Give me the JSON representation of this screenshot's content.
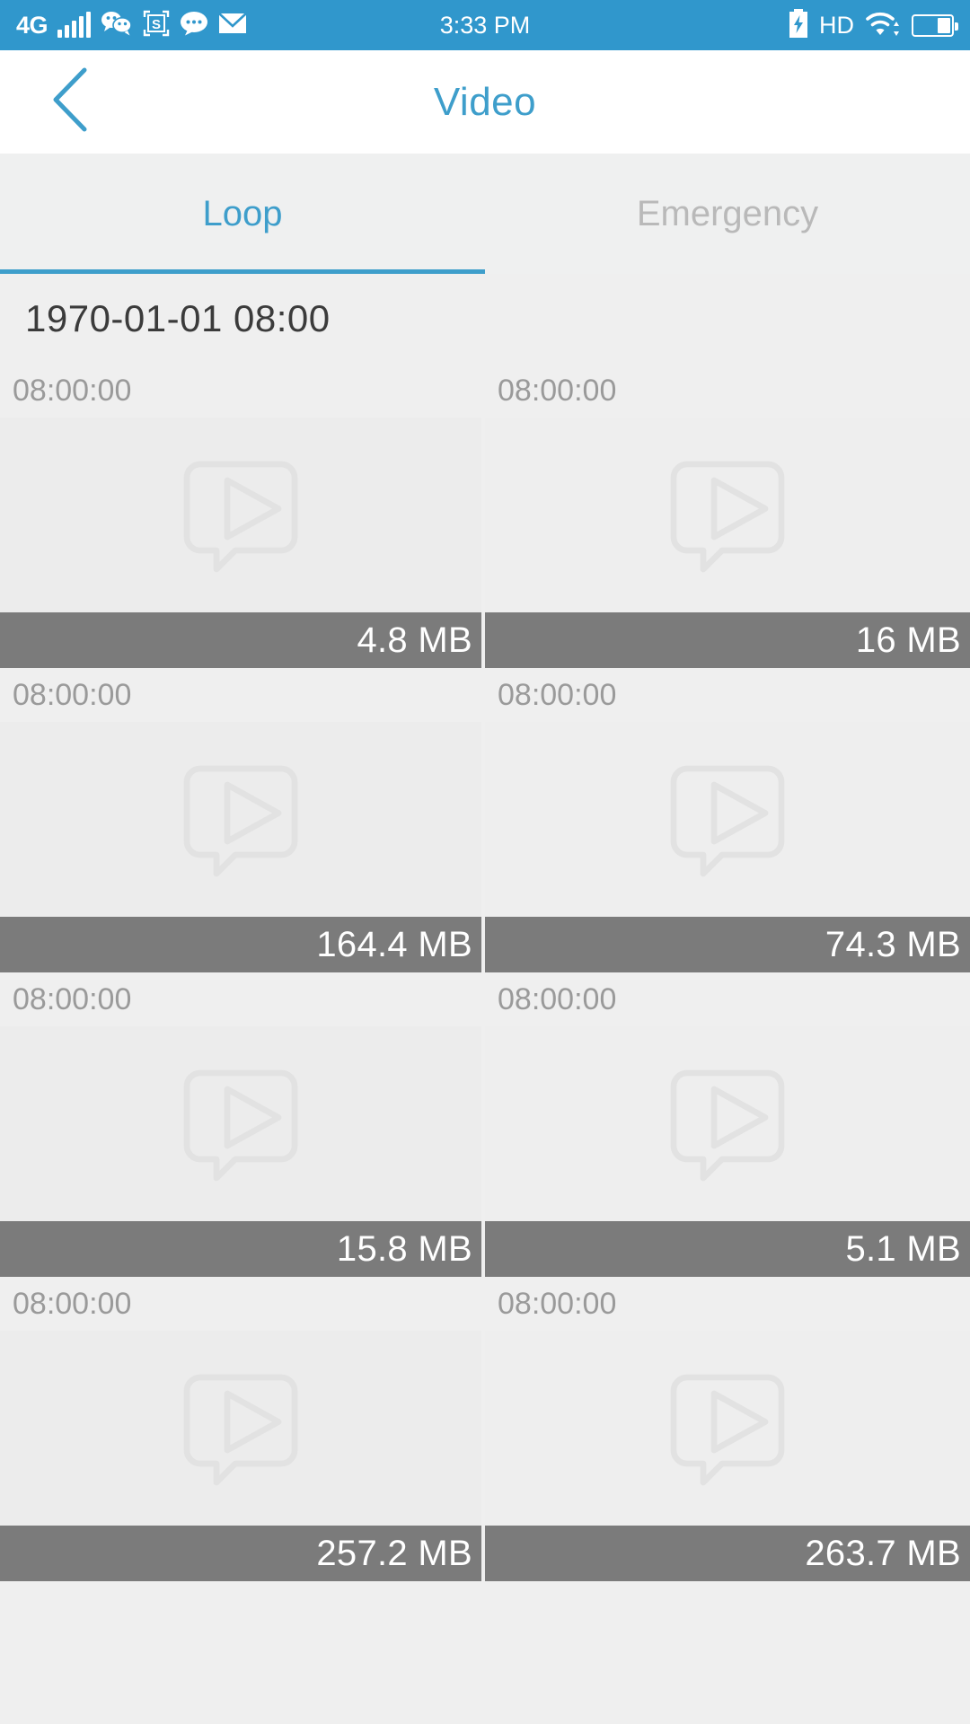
{
  "status_bar": {
    "network_label": "4G",
    "signal_bars": 5,
    "time": "3:33 PM",
    "hd_label": "HD",
    "icons": [
      "wechat-icon",
      "screenshot-s-icon",
      "chat-bubble-icon",
      "envelope-icon",
      "charging-battery-icon",
      "wifi-icon",
      "battery-icon"
    ],
    "accent_color": "#3097cc"
  },
  "header": {
    "title": "Video",
    "back_icon": "chevron-left-icon",
    "title_color": "#3e9ecb"
  },
  "tabs": {
    "items": [
      {
        "label": "Loop",
        "active": true
      },
      {
        "label": "Emergency",
        "active": false
      }
    ],
    "active_color": "#3e9ecb",
    "inactive_color": "#b9b9b9"
  },
  "date_header": "1970-01-01 08:00",
  "videos": [
    {
      "time": "08:00:00",
      "size": "4.8 MB"
    },
    {
      "time": "08:00:00",
      "size": "16 MB"
    },
    {
      "time": "08:00:00",
      "size": "164.4 MB"
    },
    {
      "time": "08:00:00",
      "size": "74.3 MB"
    },
    {
      "time": "08:00:00",
      "size": "15.8 MB"
    },
    {
      "time": "08:00:00",
      "size": "5.1 MB"
    },
    {
      "time": "08:00:00",
      "size": "257.2 MB"
    },
    {
      "time": "08:00:00",
      "size": "263.7 MB"
    }
  ],
  "thumbnail_icon": "video-play-placeholder-icon",
  "colors": {
    "page_background": "#efefef",
    "size_bar": "#7b7b7b",
    "size_text": "#ffffff",
    "timestamp_text": "#9a9a9a"
  }
}
